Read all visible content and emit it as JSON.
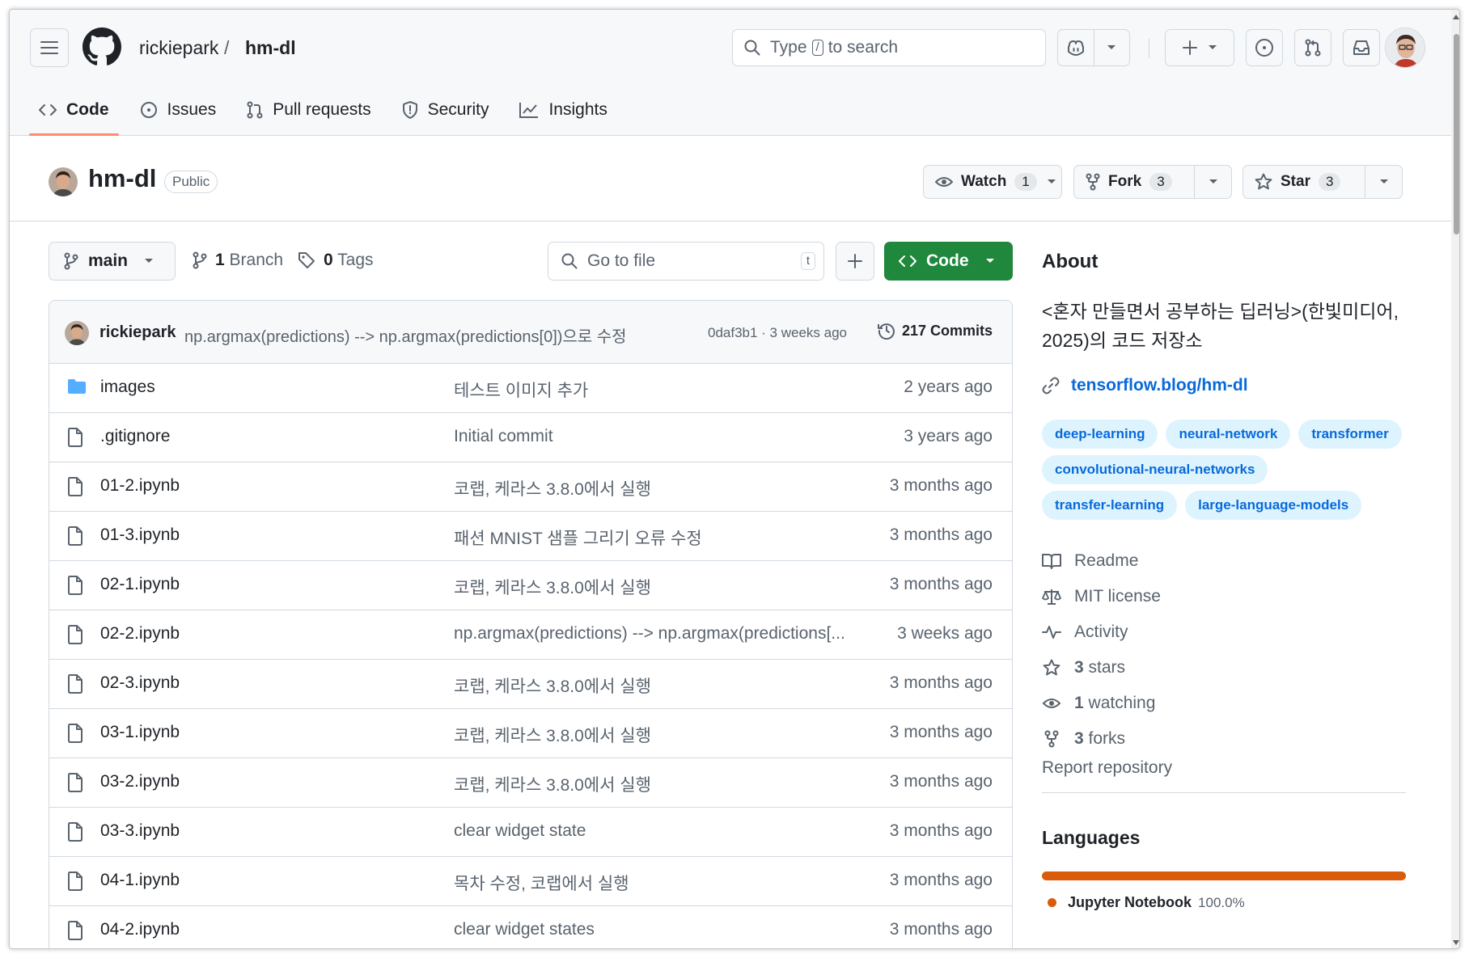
{
  "header": {
    "owner": "rickiepark",
    "separator": "/",
    "repo": "hm-dl",
    "search_prefix": "Type",
    "search_key": "/",
    "search_suffix": "to search"
  },
  "nav": {
    "tabs": [
      {
        "label": "Code",
        "icon": "code-icon"
      },
      {
        "label": "Issues",
        "icon": "issue-opened-icon"
      },
      {
        "label": "Pull requests",
        "icon": "git-pull-request-icon"
      },
      {
        "label": "Security",
        "icon": "shield-icon"
      },
      {
        "label": "Insights",
        "icon": "graph-icon"
      }
    ]
  },
  "repo": {
    "name": "hm-dl",
    "visibility": "Public",
    "watch_label": "Watch",
    "watch_count": "1",
    "fork_label": "Fork",
    "fork_count": "3",
    "star_label": "Star",
    "star_count": "3"
  },
  "branch_bar": {
    "branch": "main",
    "branches_count": "1",
    "branches_label": "Branch",
    "tags_count": "0",
    "tags_label": "Tags",
    "goto_placeholder": "Go to file",
    "goto_key": "t",
    "code_label": "Code"
  },
  "latest_commit": {
    "author": "rickiepark",
    "message": "np.argmax(predictions) --> np.argmax(predictions[0])으로 수정",
    "hash_time": "0daf3b1 · 3 weeks ago",
    "commits": "217 Commits"
  },
  "files": [
    {
      "name": "images",
      "type": "dir",
      "message": "테스트 이미지 추가",
      "time": "2 years ago"
    },
    {
      "name": ".gitignore",
      "type": "file",
      "message": "Initial commit",
      "time": "3 years ago"
    },
    {
      "name": "01-2.ipynb",
      "type": "file",
      "message": "코랩, 케라스 3.8.0에서 실행",
      "time": "3 months ago"
    },
    {
      "name": "01-3.ipynb",
      "type": "file",
      "message": "패션 MNIST 샘플 그리기 오류 수정",
      "time": "3 months ago"
    },
    {
      "name": "02-1.ipynb",
      "type": "file",
      "message": "코랩, 케라스 3.8.0에서 실행",
      "time": "3 months ago"
    },
    {
      "name": "02-2.ipynb",
      "type": "file",
      "message": "np.argmax(predictions) --> np.argmax(predictions[...",
      "time": "3 weeks ago"
    },
    {
      "name": "02-3.ipynb",
      "type": "file",
      "message": "코랩, 케라스 3.8.0에서 실행",
      "time": "3 months ago"
    },
    {
      "name": "03-1.ipynb",
      "type": "file",
      "message": "코랩, 케라스 3.8.0에서 실행",
      "time": "3 months ago"
    },
    {
      "name": "03-2.ipynb",
      "type": "file",
      "message": "코랩, 케라스 3.8.0에서 실행",
      "time": "3 months ago"
    },
    {
      "name": "03-3.ipynb",
      "type": "file",
      "message": "clear widget state",
      "time": "3 months ago"
    },
    {
      "name": "04-1.ipynb",
      "type": "file",
      "message": "목차 수정, 코랩에서 실행",
      "time": "3 months ago"
    },
    {
      "name": "04-2.ipynb",
      "type": "file",
      "message": "clear widget states",
      "time": "3 months ago"
    }
  ],
  "about": {
    "heading": "About",
    "description": "<혼자 만들면서 공부하는 딥러닝>(한빛미디어, 2025)의 코드 저장소",
    "link": "tensorflow.blog/hm-dl",
    "topics": [
      "deep-learning",
      "neural-network",
      "transformer",
      "convolutional-neural-networks",
      "transfer-learning",
      "large-language-models"
    ],
    "items": [
      {
        "icon": "book-icon",
        "count": "",
        "label": "Readme"
      },
      {
        "icon": "law-icon",
        "count": "",
        "label": "MIT license"
      },
      {
        "icon": "pulse-icon",
        "count": "",
        "label": "Activity"
      },
      {
        "icon": "star-icon",
        "count": "3",
        "label": "stars"
      },
      {
        "icon": "eye-icon",
        "count": "1",
        "label": "watching"
      },
      {
        "icon": "repo-forked-icon",
        "count": "3",
        "label": "forks"
      }
    ],
    "report": "Report repository"
  },
  "languages": {
    "heading": "Languages",
    "items": [
      {
        "name": "Jupyter Notebook",
        "percent": "100.0%",
        "color": "#da5b0b",
        "fraction": 1.0
      }
    ]
  },
  "colors": {
    "accent": "#0969da",
    "primary_button": "#1f883d",
    "active_tab_underline": "#fd8c73",
    "folder": "#54aeff"
  }
}
